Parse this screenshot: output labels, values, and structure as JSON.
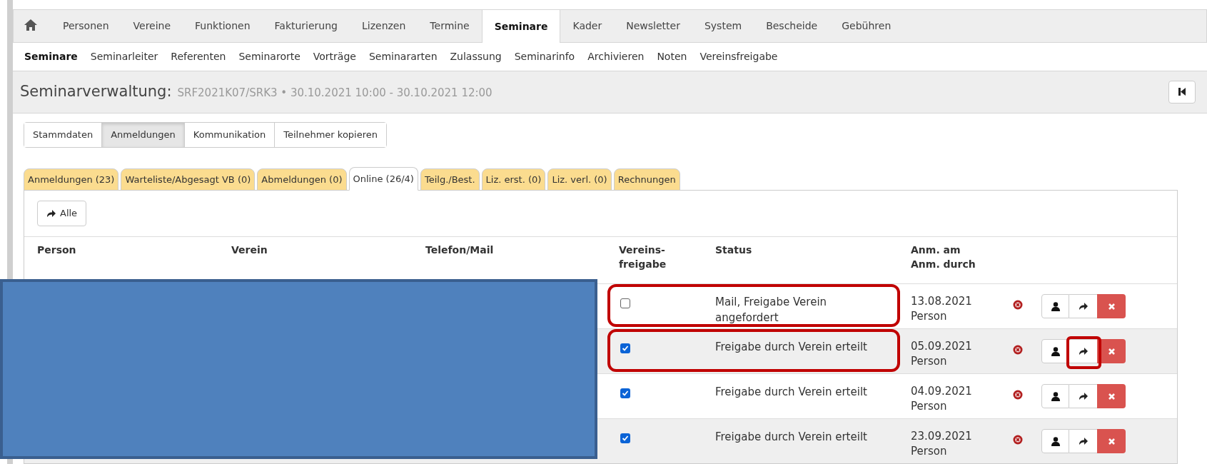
{
  "top_nav": [
    {
      "label": "Personen",
      "selected": false
    },
    {
      "label": "Vereine",
      "selected": false
    },
    {
      "label": "Funktionen",
      "selected": false
    },
    {
      "label": "Fakturierung",
      "selected": false
    },
    {
      "label": "Lizenzen",
      "selected": false
    },
    {
      "label": "Termine",
      "selected": false
    },
    {
      "label": "Seminare",
      "selected": true
    },
    {
      "label": "Kader",
      "selected": false
    },
    {
      "label": "Newsletter",
      "selected": false
    },
    {
      "label": "System",
      "selected": false
    },
    {
      "label": "Bescheide",
      "selected": false
    },
    {
      "label": "Gebühren",
      "selected": false
    }
  ],
  "sub_nav": [
    {
      "label": "Seminare",
      "selected": true
    },
    {
      "label": "Seminarleiter",
      "selected": false
    },
    {
      "label": "Referenten",
      "selected": false
    },
    {
      "label": "Seminarorte",
      "selected": false
    },
    {
      "label": "Vorträge",
      "selected": false
    },
    {
      "label": "Seminararten",
      "selected": false
    },
    {
      "label": "Zulassung",
      "selected": false
    },
    {
      "label": "Seminarinfo",
      "selected": false
    },
    {
      "label": "Archivieren",
      "selected": false
    },
    {
      "label": "Noten",
      "selected": false
    },
    {
      "label": "Vereinsfreigabe",
      "selected": false
    }
  ],
  "header": {
    "title": "Seminarverwaltung:",
    "subtitle": "SRF2021K07/SRK3 • 30.10.2021 10:00 - 30.10.2021 12:00"
  },
  "section_tabs": [
    {
      "label": "Stammdaten",
      "selected": false
    },
    {
      "label": "Anmeldungen",
      "selected": true
    },
    {
      "label": "Kommunikation",
      "selected": false
    },
    {
      "label": "Teilnehmer kopieren",
      "selected": false
    }
  ],
  "tabs": [
    {
      "label": "Anmeldungen (23)",
      "selected": false
    },
    {
      "label": "Warteliste/Abgesagt VB (0)",
      "selected": false
    },
    {
      "label": "Abmeldungen (0)",
      "selected": false
    },
    {
      "label": "Online (26/4)",
      "selected": true
    },
    {
      "label": "Teilg./Best.",
      "selected": false
    },
    {
      "label": "Liz. erst. (0)",
      "selected": false
    },
    {
      "label": "Liz. verl. (0)",
      "selected": false
    },
    {
      "label": "Rechnungen",
      "selected": false
    }
  ],
  "toolbar_button": "Alle",
  "table": {
    "columns": [
      "Person",
      "Verein",
      "Telefon/Mail",
      "Vereins-\nfreigabe",
      "Status",
      "Anm. am\nAnm. durch"
    ],
    "rows": [
      {
        "checked": false,
        "status": "Mail, Freigabe Verein angefordert",
        "date": "13.08.2021",
        "by": "Person",
        "highlighted": true,
        "forward_highlighted": false
      },
      {
        "checked": true,
        "status": "Freigabe durch Verein erteilt",
        "date": "05.09.2021",
        "by": "Person",
        "highlighted": true,
        "forward_highlighted": true
      },
      {
        "checked": true,
        "status": "Freigabe durch Verein erteilt",
        "date": "04.09.2021",
        "by": "Person",
        "highlighted": false,
        "forward_highlighted": false
      },
      {
        "checked": true,
        "status": "Freigabe durch Verein erteilt",
        "date": "23.09.2021",
        "by": "Person",
        "highlighted": false,
        "forward_highlighted": false
      }
    ]
  }
}
